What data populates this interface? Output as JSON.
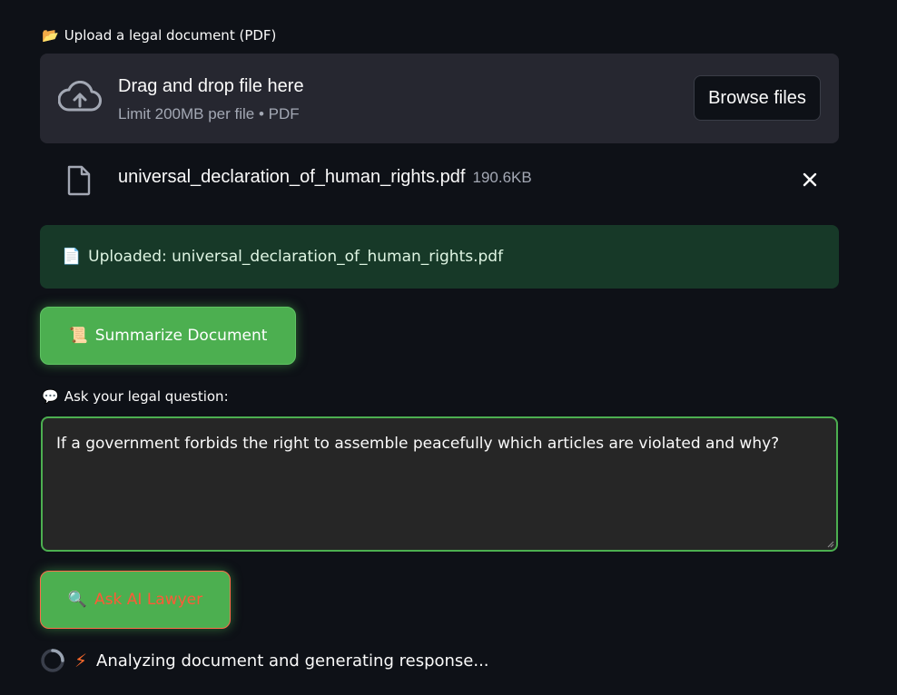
{
  "upload": {
    "label_emoji": "📂",
    "label": "Upload a legal document (PDF)",
    "drop_title": "Drag and drop file here",
    "drop_subtitle": "Limit 200MB per file • PDF",
    "browse_label": "Browse files",
    "file": {
      "name": "universal_declaration_of_human_rights.pdf",
      "size": "190.6KB"
    }
  },
  "alert": {
    "emoji": "📄",
    "text": "Uploaded: universal_declaration_of_human_rights.pdf"
  },
  "summarize": {
    "emoji": "📜",
    "label": "Summarize Document"
  },
  "question": {
    "label_emoji": "💬",
    "label": "Ask your legal question:",
    "value": "If a government forbids the right to assemble peacefully which articles are violated and why?"
  },
  "ask": {
    "emoji": "🔍",
    "label": "Ask AI Lawyer"
  },
  "status": {
    "icon": "⚡",
    "text": "Analyzing document and generating response..."
  },
  "colors": {
    "background": "#0e1117",
    "accent_green": "#4caf50",
    "alert_bg": "#173928",
    "ask_text": "#ff5a36"
  }
}
